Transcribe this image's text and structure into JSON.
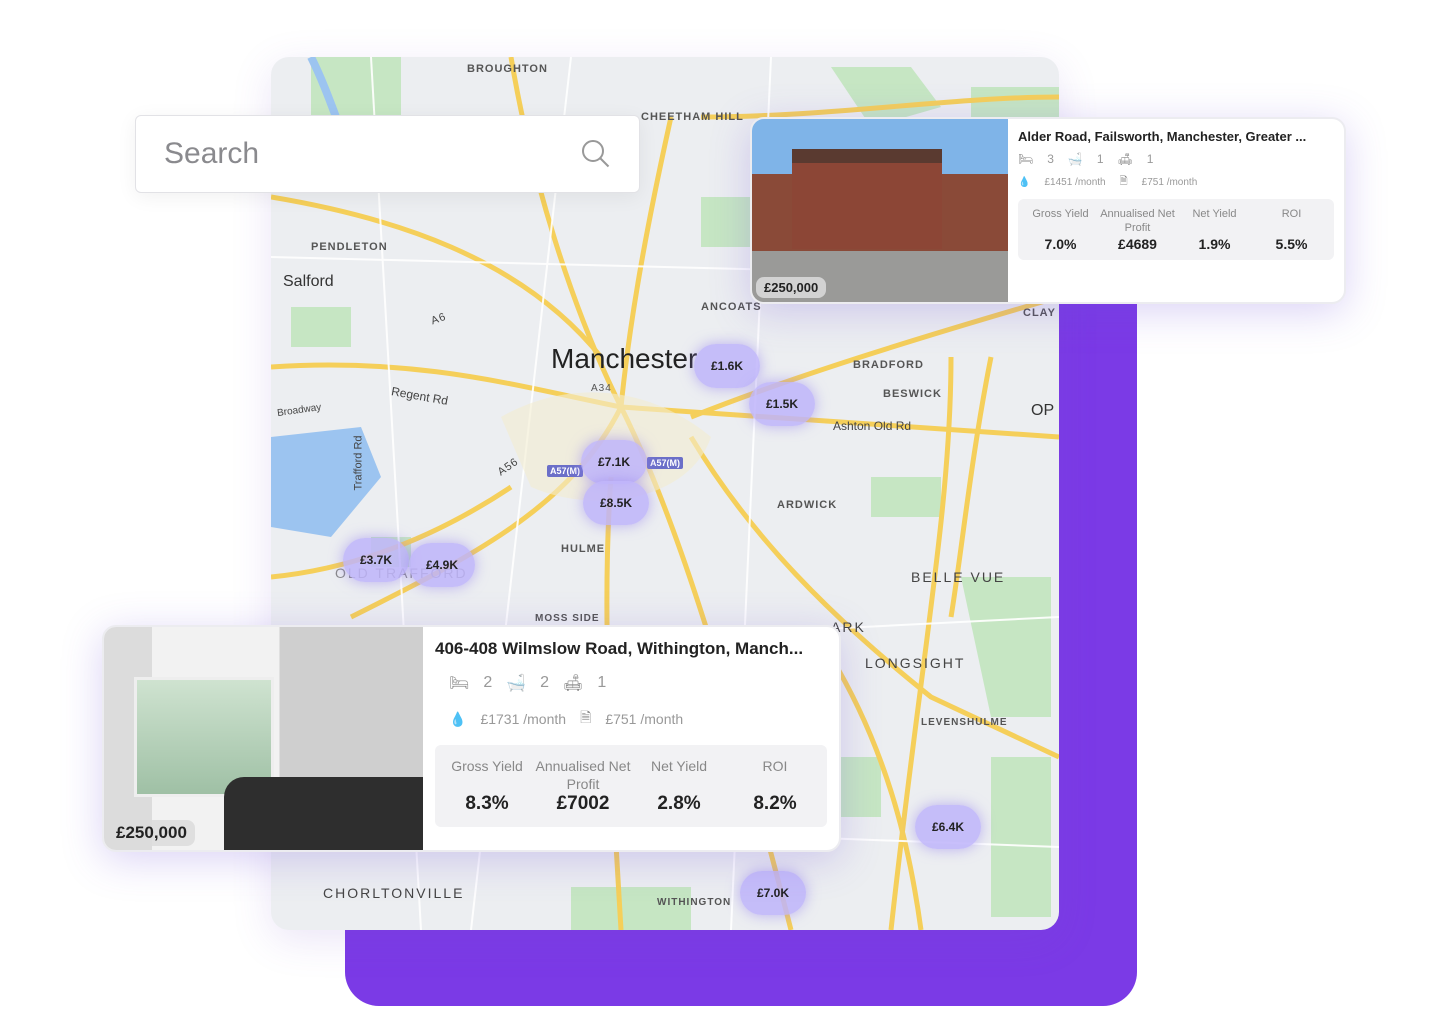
{
  "search": {
    "placeholder": "Search"
  },
  "map": {
    "labels": {
      "broughton": "BROUGHTON",
      "cheetham": "CHEETHAM HILL",
      "salford": "Salford",
      "pendleton": "PENDLETON",
      "manchester": "Manchester",
      "ancoats": "ANCOATS",
      "bradford": "BRADFORD",
      "beswick": "BESWICK",
      "ashton": "Ashton Old Rd",
      "ardwick": "ARDWICK",
      "hulme": "HULME",
      "old_trafford": "OLD TRAFFORD",
      "belle_vue": "BELLE VUE",
      "longsight": "LONGSIGHT",
      "levenshulme": "LEVENSHULME",
      "chorltonville": "CHORLTONVILLE",
      "withington": "WITHINGTON",
      "regent": "Regent Rd",
      "trafford": "Trafford Rd",
      "broadway": "Broadway",
      "moss_side": "MOSS SIDE",
      "clayton": "CLAY",
      "op": "OP",
      "park": "ARK",
      "a34": "A34",
      "a6": "A6",
      "a56": "A56",
      "a57m": "A57(M)"
    },
    "bubbles": [
      "£1.6K",
      "£1.5K",
      "£7.1K",
      "£8.5K",
      "£3.7K",
      "£4.9K",
      "£6.4K",
      "£7.0K"
    ]
  },
  "cards": [
    {
      "title": "Alder Road, Failsworth, Manchester, Greater ...",
      "price": "£250,000",
      "beds": "3",
      "baths": "1",
      "receptions": "1",
      "rent": "£1451 /month",
      "costs": "£751 /month",
      "stats": [
        {
          "k": "Gross Yield",
          "v": "7.0%"
        },
        {
          "k": "Annualised Net Profit",
          "v": "£4689"
        },
        {
          "k": "Net Yield",
          "v": "1.9%"
        },
        {
          "k": "ROI",
          "v": "5.5%"
        }
      ]
    },
    {
      "title": "406-408 Wilmslow Road, Withington, Manch...",
      "price": "£250,000",
      "beds": "2",
      "baths": "2",
      "receptions": "1",
      "rent": "£1731 /month",
      "costs": "£751 /month",
      "stats": [
        {
          "k": "Gross Yield",
          "v": "8.3%"
        },
        {
          "k": "Annualised Net Profit",
          "v": "£7002"
        },
        {
          "k": "Net Yield",
          "v": "2.8%"
        },
        {
          "k": "ROI",
          "v": "8.2%"
        }
      ]
    }
  ],
  "colors": {
    "accent": "#7b3ae6",
    "bubble": "#beb4fa",
    "road": "#f5cf5a",
    "park": "#c5e8c2",
    "water": "#9cc4f0"
  }
}
